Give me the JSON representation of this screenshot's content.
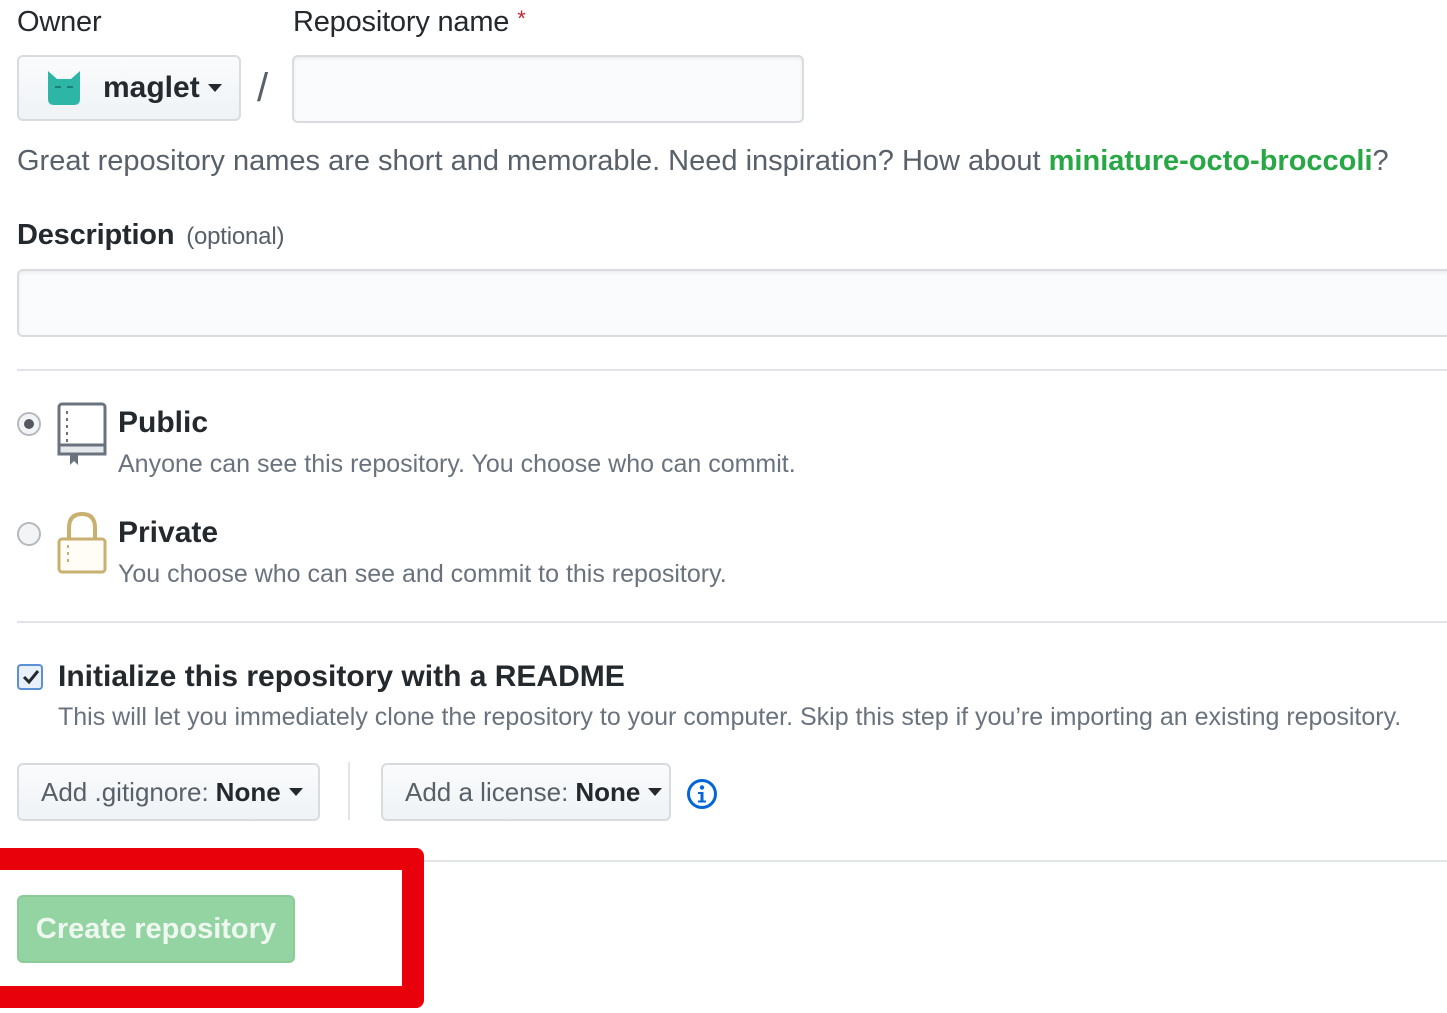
{
  "owner": {
    "label": "Owner",
    "selected": "maglet",
    "avatar_icon": "cat-avatar-icon",
    "separator": "/"
  },
  "repository_name": {
    "label": "Repository name",
    "required_marker": "*",
    "value": ""
  },
  "hint": {
    "text": "Great repository names are short and memorable. Need inspiration? How about ",
    "suggestion": "miniature-octo-broccoli",
    "suffix": "?"
  },
  "description": {
    "label": "Description",
    "optional": "(optional)",
    "value": ""
  },
  "visibility": {
    "selected": "public",
    "options": [
      {
        "key": "public",
        "title": "Public",
        "description": "Anyone can see this repository. You choose who can commit.",
        "icon": "repo-book-icon"
      },
      {
        "key": "private",
        "title": "Private",
        "description": "You choose who can see and commit to this repository.",
        "icon": "lock-icon"
      }
    ]
  },
  "readme": {
    "checked": true,
    "title": "Initialize this repository with a README",
    "description": "This will let you immediately clone the repository to your computer. Skip this step if you’re importing an existing repository."
  },
  "gitignore": {
    "label": "Add .gitignore:",
    "value": "None"
  },
  "license": {
    "label": "Add a license:",
    "value": "None",
    "info_icon": "info-icon"
  },
  "submit": {
    "label": "Create repository",
    "enabled": false
  },
  "colors": {
    "accent_green": "#28a745",
    "button_disabled_green": "#94d3a2",
    "highlight_red": "#e8000b",
    "info_blue": "#0366d6",
    "required_red": "#cb2431"
  }
}
